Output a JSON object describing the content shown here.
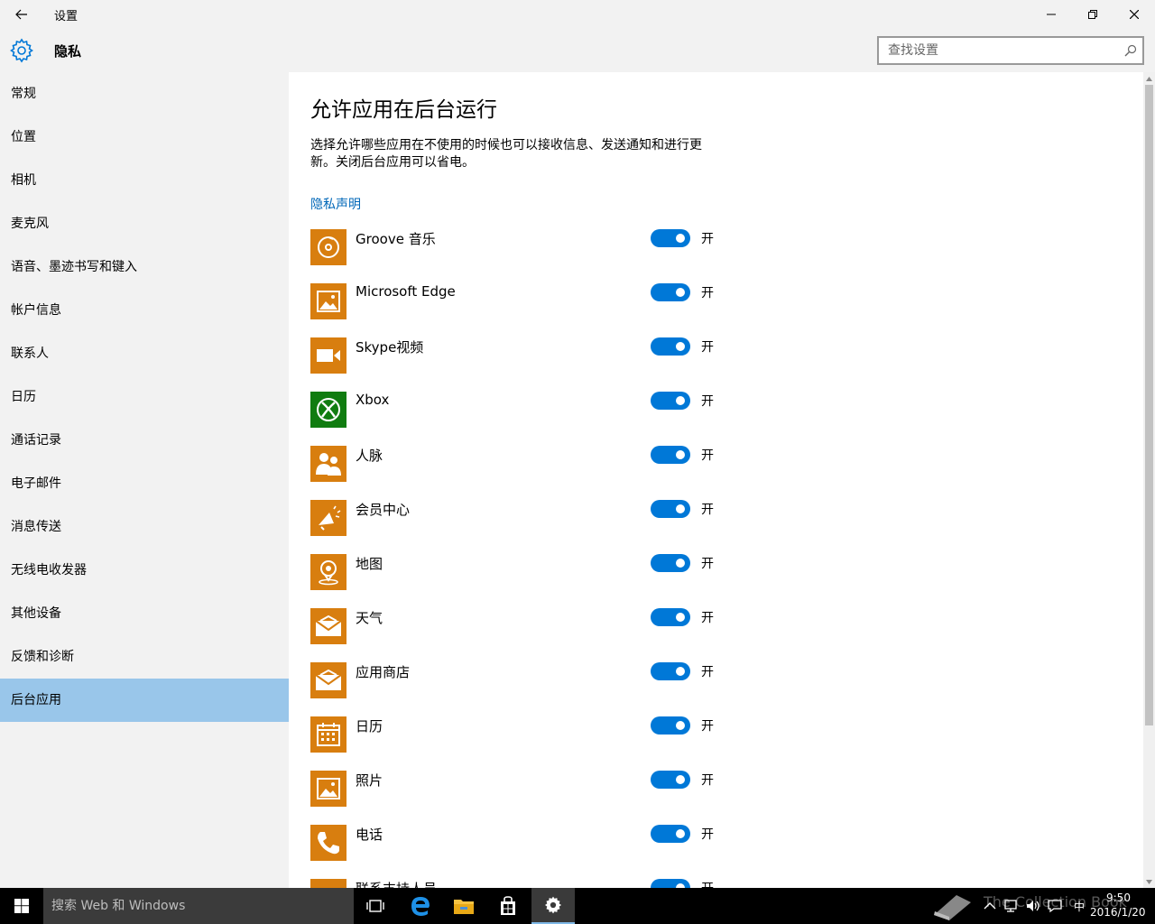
{
  "window": {
    "title": "设置",
    "minimize": "minimize-icon",
    "maximize": "restore-icon",
    "close": "close-icon"
  },
  "header": {
    "page_title": "隐私",
    "search_placeholder": "查找设置"
  },
  "sidebar": {
    "selected": "后台应用",
    "items": [
      {
        "label": "常规"
      },
      {
        "label": "位置"
      },
      {
        "label": "相机"
      },
      {
        "label": "麦克风"
      },
      {
        "label": "语音、墨迹书写和键入"
      },
      {
        "label": "帐户信息"
      },
      {
        "label": "联系人"
      },
      {
        "label": "日历"
      },
      {
        "label": "通话记录"
      },
      {
        "label": "电子邮件"
      },
      {
        "label": "消息传送"
      },
      {
        "label": "无线电收发器"
      },
      {
        "label": "其他设备"
      },
      {
        "label": "反馈和诊断"
      },
      {
        "label": "后台应用"
      }
    ]
  },
  "main": {
    "title": "允许应用在后台运行",
    "description": "选择允许哪些应用在不使用的时候也可以接收信息、发送通知和进行更新。关闭后台应用可以省电。",
    "privacy_link": "隐私声明",
    "apps": [
      {
        "name": "Groove 音乐",
        "state": "开",
        "on": true,
        "icon": "music-disc-icon",
        "color": "#d87e0f"
      },
      {
        "name": "Microsoft Edge",
        "state": "开",
        "on": true,
        "icon": "image-icon",
        "color": "#d87e0f"
      },
      {
        "name": "Skype视频",
        "state": "开",
        "on": true,
        "icon": "video-camera-icon",
        "color": "#d87e0f"
      },
      {
        "name": "Xbox",
        "state": "开",
        "on": true,
        "icon": "xbox-icon",
        "color": "#107c10"
      },
      {
        "name": "人脉",
        "state": "开",
        "on": true,
        "icon": "people-icon",
        "color": "#d87e0f"
      },
      {
        "name": "会员中心",
        "state": "开",
        "on": true,
        "icon": "megaphone-icon",
        "color": "#d87e0f"
      },
      {
        "name": "地图",
        "state": "开",
        "on": true,
        "icon": "map-pin-icon",
        "color": "#d87e0f"
      },
      {
        "name": "天气",
        "state": "开",
        "on": true,
        "icon": "envelope-icon",
        "color": "#d87e0f"
      },
      {
        "name": "应用商店",
        "state": "开",
        "on": true,
        "icon": "envelope-icon",
        "color": "#d87e0f"
      },
      {
        "name": "日历",
        "state": "开",
        "on": true,
        "icon": "calendar-icon",
        "color": "#d87e0f"
      },
      {
        "name": "照片",
        "state": "开",
        "on": true,
        "icon": "image-icon",
        "color": "#d87e0f"
      },
      {
        "name": "电话",
        "state": "开",
        "on": true,
        "icon": "phone-icon",
        "color": "#d87e0f"
      },
      {
        "name": "联系支持人员",
        "state": "开",
        "on": true,
        "icon": "support-icon",
        "color": "#d87e0f"
      }
    ]
  },
  "taskbar": {
    "search_placeholder": "搜索 Web 和 Windows",
    "ime": "中",
    "time": "9:50",
    "date": "2016/1/20",
    "watermark": "The Collection Book"
  },
  "colors": {
    "accent": "#0078d7",
    "selected_nav": "#99c6ea",
    "app_tile": "#d87e0f",
    "link": "#0067b8"
  }
}
